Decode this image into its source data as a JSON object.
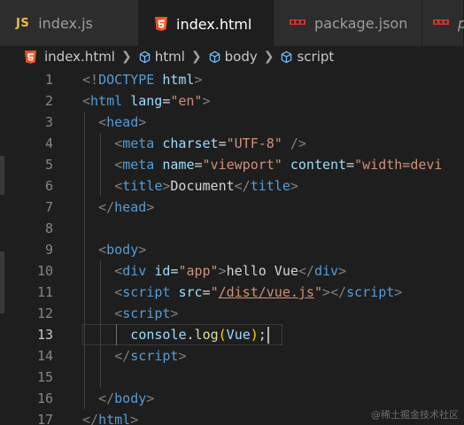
{
  "tabs": [
    {
      "label": "index.js",
      "icon": "js-icon",
      "icon_text": "JS",
      "active": false
    },
    {
      "label": "index.html",
      "icon": "html5-icon",
      "active": true,
      "modified": true
    },
    {
      "label": "package.json",
      "icon": "npm-icon",
      "active": false
    },
    {
      "label": "p",
      "icon": "npm-icon",
      "active": false
    }
  ],
  "breadcrumb": [
    "index.html",
    "html",
    "body",
    "script"
  ],
  "editor": {
    "current_line": 13,
    "lines": [
      {
        "n": "1",
        "indent": 0,
        "tokens": [
          [
            "punc",
            "<!"
          ],
          [
            "tag",
            "DOCTYPE"
          ],
          [
            "text",
            " "
          ],
          [
            "attr",
            "html"
          ],
          [
            "punc",
            ">"
          ]
        ]
      },
      {
        "n": "2",
        "indent": 0,
        "tokens": [
          [
            "punc",
            "<"
          ],
          [
            "tag",
            "html"
          ],
          [
            "text",
            " "
          ],
          [
            "attr",
            "lang"
          ],
          [
            "text",
            "="
          ],
          [
            "str",
            "\"en\""
          ],
          [
            "punc",
            ">"
          ]
        ]
      },
      {
        "n": "3",
        "indent": 1,
        "tokens": [
          [
            "punc",
            "<"
          ],
          [
            "tag",
            "head"
          ],
          [
            "punc",
            ">"
          ]
        ]
      },
      {
        "n": "4",
        "indent": 2,
        "tokens": [
          [
            "punc",
            "<"
          ],
          [
            "tag",
            "meta"
          ],
          [
            "text",
            " "
          ],
          [
            "attr",
            "charset"
          ],
          [
            "text",
            "="
          ],
          [
            "str",
            "\"UTF-8\""
          ],
          [
            "text",
            " "
          ],
          [
            "punc",
            "/>"
          ]
        ]
      },
      {
        "n": "5",
        "indent": 2,
        "tokens": [
          [
            "punc",
            "<"
          ],
          [
            "tag",
            "meta"
          ],
          [
            "text",
            " "
          ],
          [
            "attr",
            "name"
          ],
          [
            "text",
            "="
          ],
          [
            "str",
            "\"viewport\""
          ],
          [
            "text",
            " "
          ],
          [
            "attr",
            "content"
          ],
          [
            "text",
            "="
          ],
          [
            "str",
            "\"width=devi"
          ]
        ]
      },
      {
        "n": "6",
        "indent": 2,
        "tokens": [
          [
            "punc",
            "<"
          ],
          [
            "tag",
            "title"
          ],
          [
            "punc",
            ">"
          ],
          [
            "text",
            "Document"
          ],
          [
            "punc",
            "</"
          ],
          [
            "tag",
            "title"
          ],
          [
            "punc",
            ">"
          ]
        ]
      },
      {
        "n": "7",
        "indent": 1,
        "tokens": [
          [
            "punc",
            "</"
          ],
          [
            "tag",
            "head"
          ],
          [
            "punc",
            ">"
          ]
        ]
      },
      {
        "n": "8",
        "indent": 0,
        "tokens": []
      },
      {
        "n": "9",
        "indent": 1,
        "tokens": [
          [
            "punc",
            "<"
          ],
          [
            "tag",
            "body"
          ],
          [
            "punc",
            ">"
          ]
        ]
      },
      {
        "n": "10",
        "indent": 2,
        "tokens": [
          [
            "punc",
            "<"
          ],
          [
            "tag",
            "div"
          ],
          [
            "text",
            " "
          ],
          [
            "attr",
            "id"
          ],
          [
            "text",
            "="
          ],
          [
            "str",
            "\"app\""
          ],
          [
            "punc",
            ">"
          ],
          [
            "text",
            "hello Vue"
          ],
          [
            "punc",
            "</"
          ],
          [
            "tag",
            "div"
          ],
          [
            "punc",
            ">"
          ]
        ]
      },
      {
        "n": "11",
        "indent": 2,
        "tokens": [
          [
            "punc",
            "<"
          ],
          [
            "tag",
            "script"
          ],
          [
            "text",
            " "
          ],
          [
            "attr",
            "src"
          ],
          [
            "text",
            "="
          ],
          [
            "str",
            "\""
          ],
          [
            "strlink",
            "/dist/vue.js"
          ],
          [
            "str",
            "\""
          ],
          [
            "punc",
            "></"
          ],
          [
            "tag",
            "script"
          ],
          [
            "punc",
            ">"
          ]
        ]
      },
      {
        "n": "12",
        "indent": 2,
        "tokens": [
          [
            "punc",
            "<"
          ],
          [
            "tag",
            "script"
          ],
          [
            "punc",
            ">"
          ]
        ]
      },
      {
        "n": "13",
        "indent": 3,
        "tokens": [
          [
            "ident",
            "console"
          ],
          [
            "text",
            "."
          ],
          [
            "func",
            "log"
          ],
          [
            "paren",
            "("
          ],
          [
            "ident",
            "Vue"
          ],
          [
            "paren",
            ")"
          ],
          [
            "text",
            ";"
          ]
        ]
      },
      {
        "n": "14",
        "indent": 2,
        "tokens": [
          [
            "punc",
            "</"
          ],
          [
            "tag",
            "script"
          ],
          [
            "punc",
            ">"
          ]
        ]
      },
      {
        "n": "15",
        "indent": 0,
        "tokens": []
      },
      {
        "n": "16",
        "indent": 1,
        "tokens": [
          [
            "punc",
            "</"
          ],
          [
            "tag",
            "body"
          ],
          [
            "punc",
            ">"
          ]
        ]
      },
      {
        "n": "17",
        "indent": 0,
        "tokens": [
          [
            "punc",
            "</"
          ],
          [
            "tag",
            "html"
          ],
          [
            "punc",
            ">"
          ]
        ]
      }
    ]
  },
  "watermark": "@稀土掘金技术社区",
  "colors": {
    "background": "#1e1e1e",
    "tag": "#569cd6",
    "attribute": "#9cdcfe",
    "string": "#ce9178",
    "function": "#dcdcaa",
    "bracket": "#ffd700",
    "js_icon": "#e8c33b",
    "html_icon": "#e44d26",
    "npm_icon": "#cb3837"
  }
}
